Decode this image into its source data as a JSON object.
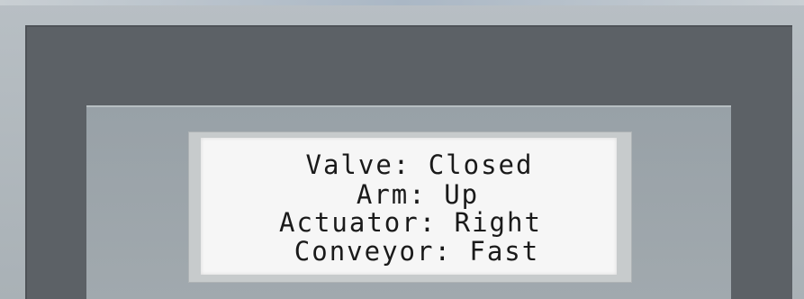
{
  "lcd": {
    "lines": [
      "Valve: Closed",
      "Arm: Up",
      "Actuator: Right",
      "Conveyor: Fast"
    ]
  }
}
